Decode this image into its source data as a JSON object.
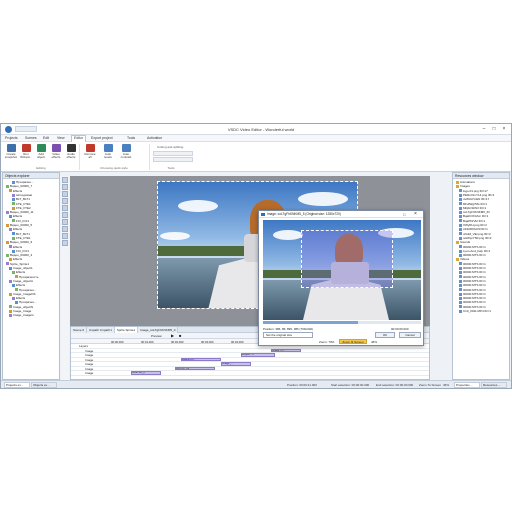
{
  "window": {
    "title": "VSDC Video Editor - Wonderful world"
  },
  "menu": [
    "Projects",
    "Scenes",
    "Edit",
    "View",
    "Editor",
    "Export project",
    "Tools",
    "Activation"
  ],
  "menu_active_index": 4,
  "ribbon": {
    "buttons": [
      {
        "label": "Create snapshot",
        "icon": "camera-icon",
        "color": "#3f6fa8"
      },
      {
        "label": "Run Wizard...",
        "icon": "wizard-icon",
        "color": "#c0392b"
      },
      {
        "label": "Add object",
        "icon": "add-object-icon",
        "color": "#2e8b57"
      },
      {
        "label": "Video effects",
        "icon": "video-effects-icon",
        "color": "#7a4fb0"
      },
      {
        "label": "Audio effects",
        "icon": "audio-effects-icon",
        "color": "#333333"
      },
      {
        "label": "Remove all",
        "icon": "remove-all-icon",
        "color": "#c0392b"
      },
      {
        "label": "Auto levels",
        "icon": "auto-levels-icon",
        "color": "#4a7fc1"
      },
      {
        "label": "Auto contrast",
        "icon": "auto-contrast-icon",
        "color": "#4a7fc1"
      }
    ],
    "groups": [
      "Editing",
      "Choosing quick style",
      "Tools"
    ],
    "tools_caption": "Cutting and splitting"
  },
  "objects_explorer": {
    "title": "Objects explorer",
    "rows": [
      "Прозрачно...",
      "Видео_00000_7",
      "Effects",
      "Автоуровни",
      "BLT_BLT1",
      "FTE_FTE1",
      "FTE_FTE2",
      "Видео_00000_11",
      "Effects",
      "FCI_FCI1",
      "Видео_00000_5",
      "Effects",
      "BLT_BLT1",
      "FTE_FTE1",
      "Видео_00000_9",
      "Effects",
      "FCI_FCI1",
      "Видео_00000_3",
      "Effects",
      "Sprite_Sprite1",
      "Image_object1",
      "Effects",
      "Прозрачность",
      "Image_objectA",
      "Effects",
      "Прозрачно...",
      "Image_ImageDS",
      "Effects",
      "Прозрачно...",
      "Image_objectN",
      "Image_Image",
      "Image_ImageG"
    ],
    "bottom_tabs": [
      "Projects ex...",
      "Objects ex..."
    ]
  },
  "timeline": {
    "tabs": [
      "Scene 0",
      "Спрайт Спрайт1",
      "Sprite Sprite1",
      "Image_coLTgFhKNKM5_0"
    ],
    "active_tab": 2,
    "controls": [
      "Preview"
    ],
    "ruler": [
      "00:00.000",
      "00:01.000",
      "00:02.000",
      "00:03.000",
      "00:04.000",
      "00:05.000",
      "00:06.000",
      "00:07.000",
      "00:08.000",
      "00:09.000",
      "00:10.000"
    ],
    "layers_header": "Layers",
    "rows": [
      "Image",
      "Image",
      "Image",
      "Image",
      "Image",
      "Image"
    ],
    "clips": [
      "Image_ct...",
      "WMjcd...5",
      "BqaNKOx...",
      "Image_...",
      "ccoTcfh_01",
      "mcaT3m_0"
    ]
  },
  "dialog": {
    "title": "Image: coLTgFhKNKM5_5 (Original size: 1280x720)",
    "position_text": "Position: 386, 86; 895, 386 (709x302)",
    "time": "00:00:00.000",
    "ok": "OK",
    "cancel": "Cancel",
    "dropdown": "Set the original size",
    "zoom_label": "Zoom: 70%",
    "zoom_fit": "Zoom fit Screen",
    "zoom_pct": "46%"
  },
  "resources": {
    "title": "Resources window",
    "rows": [
      "Animations",
      "Images",
      "logo-01.png ID=17",
      "PERuVimY14.png ID=1",
      "uvWIAYmEN ID=17",
      "RFdIWg7lZs ID=1",
      "MfqbnSlIhO ID=1",
      "coLTgFhKNKM5_ID",
      "BqaKOXzZvc ID=1",
      "BqaPDrVkI ID=1",
      "XWyRH.png ID=2",
      "c2i1RFDHV0 ID=1",
      "uNuM_VEI.png ID=3",
      "uckPqcYfW.png ID=2",
      "Sounds",
      "00000.MTS ID=1",
      "Lyon-And_Italy ID=1",
      "00000.MTS ID=1",
      "Videos",
      "00000.MTS ID=1",
      "00000.MTS ID=1",
      "00000.MTS ID=1",
      "00000.MTS ID=1",
      "00000.MTS ID=1",
      "00000.MTS ID=1",
      "00000.MTS ID=1",
      "00000.MTS ID=1",
      "00000.MTS ID=1",
      "00000.MTS ID=1",
      "00000.MTS ID=1",
      "C10_0011.MP4 ID=1"
    ],
    "bottom_tabs": [
      "Properties ...",
      "Resources ..."
    ]
  },
  "status": {
    "position": "Position: 00:00:21.000",
    "start_selection": "Start selection: 00:00:00.000",
    "end_selection": "End selection: 00:00:00.000",
    "zoom": "Zoom To Screen",
    "zoom_pct": "46%"
  }
}
